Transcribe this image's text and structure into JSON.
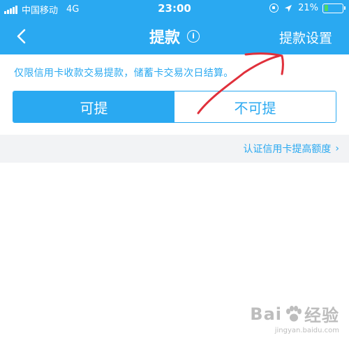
{
  "status_bar": {
    "carrier": "中国移动",
    "network": "4G",
    "time": "23:00",
    "battery_percent": "21%",
    "battery_level": 0.21,
    "battery_color": "#4cd964"
  },
  "nav": {
    "title": "提款",
    "info_glyph": "i",
    "action_label": "提款设置"
  },
  "notice_text": "仅限信用卡收款交易提款，储蓄卡交易次日结算。",
  "tabs": [
    {
      "label": "可提",
      "active": true
    },
    {
      "label": "不可提",
      "active": false
    }
  ],
  "raise_limit_link": "认证信用卡提高额度",
  "watermark": {
    "brand": "Bai",
    "brand_suffix": "经验",
    "url": "jingyan.baidu.com"
  },
  "colors": {
    "accent": "#2aa9f1",
    "annotation": "#e0303b",
    "strip_bg": "#f2f3f5"
  }
}
